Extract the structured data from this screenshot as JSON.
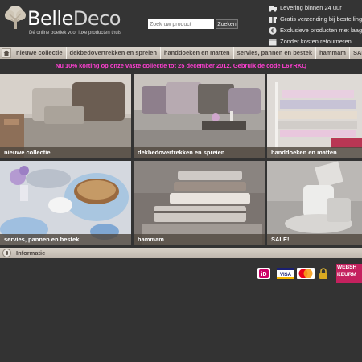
{
  "brand": {
    "name_part1": "Belle",
    "name_part2": "Deco",
    "tagline": "Dé online boetiek voor luxe producten thuis"
  },
  "search": {
    "placeholder": "Zoek uw product",
    "button_label": "Zoeken"
  },
  "usps": [
    {
      "icon": "truck-icon",
      "text": "Levering binnen 24 uur"
    },
    {
      "icon": "gift-icon",
      "text": "Gratis verzending bij bestellingen v"
    },
    {
      "icon": "euro-icon",
      "text": "Exclusieve producten met laagste p"
    },
    {
      "icon": "box-icon",
      "text": "Zonder kosten retourneren"
    }
  ],
  "nav": {
    "home_icon": "home-icon",
    "items": [
      "nieuwe collectie",
      "dekbedovertrekken en spreien",
      "handdoeken en matten",
      "servies, pannen en bestek",
      "hammam",
      "SALE!"
    ]
  },
  "promo": {
    "text": "Nu 10% korting op onze vaste collectie tot 25 december 2012. Gebruik de code L6YRKQ",
    "color": "#ff3fd2"
  },
  "tiles": [
    {
      "label": "nieuwe collectie"
    },
    {
      "label": "dekbedovertrekken en spreien"
    },
    {
      "label": "handdoeken en matten"
    },
    {
      "label": "servies, pannen en bestek"
    },
    {
      "label": "hammam"
    },
    {
      "label": "SALE!"
    }
  ],
  "info": {
    "title": "Informatie"
  },
  "payment": {
    "logos": [
      "ideal-logo",
      "visa-logo",
      "mastercard-logo",
      "lock-icon"
    ],
    "ideal_text": "iD",
    "visa_text": "VISA",
    "keurmerk_line1": "WEBSH",
    "keurmerk_line2": "KEURM"
  }
}
